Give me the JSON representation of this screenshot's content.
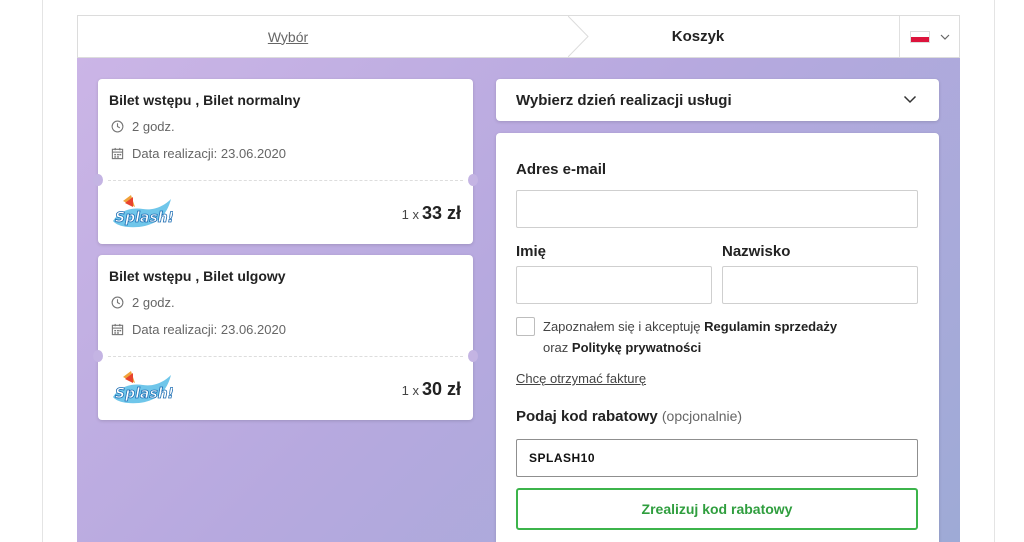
{
  "steps": {
    "step1": "Wybór",
    "step2": "Koszyk",
    "language_icon": "poland-flag-icon"
  },
  "tickets": [
    {
      "title": "Bilet wstępu , Bilet normalny",
      "duration": "2 godz.",
      "date": "Data realizacji: 23.06.2020",
      "logo": "Splash!",
      "quantity": "1 x",
      "price": "33 zł"
    },
    {
      "title": "Bilet wstępu , Bilet ulgowy",
      "duration": "2 godz.",
      "date": "Data realizacji: 23.06.2020",
      "logo": "Splash!",
      "quantity": "1 x",
      "price": "30 zł"
    }
  ],
  "date_select": {
    "label": "Wybierz dzień realizacji usługi"
  },
  "form": {
    "email_label": "Adres e-mail",
    "email_value": "",
    "first_name_label": "Imię",
    "first_name_value": "",
    "last_name_label": "Nazwisko",
    "last_name_value": "",
    "consent_prefix": "Zapoznałem się i akceptuję ",
    "consent_terms": "Regulamin sprzedaży",
    "consent_mid": " oraz ",
    "consent_privacy": "Politykę prywatności",
    "invoice_link": "Chcę otrzymać fakturę",
    "discount_label": "Podaj kod rabatowy",
    "discount_optional": "(opcjonalnie)",
    "discount_value": "SPLASH10",
    "redeem_button": "Zrealizuj kod rabatowy"
  },
  "colors": {
    "accent_green": "#3cb44b",
    "gradient_start": "#cbb5e6",
    "gradient_end": "#9eaad6"
  }
}
